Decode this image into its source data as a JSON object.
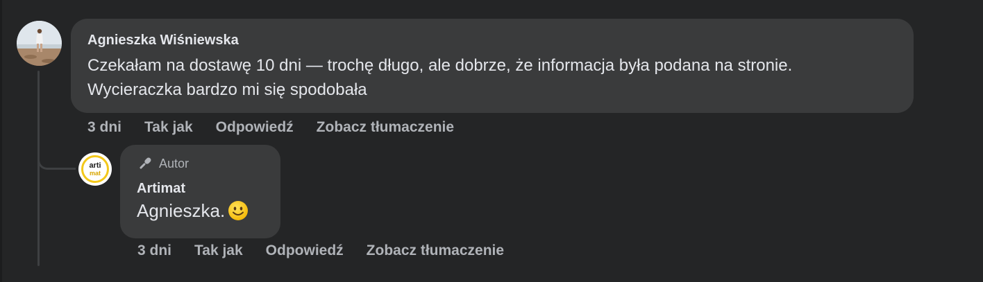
{
  "main_comment": {
    "author": "Agnieszka Wiśniewska",
    "text": "Czekałam na dostawę 10 dni — trochę długo, ale dobrze, że informacja była podana na stronie. Wycieraczka bardzo mi się spodobała",
    "time": "3 dni",
    "actions": {
      "like": "Tak jak",
      "reply": "Odpowiedź",
      "translate": "Zobacz tłumaczenie"
    }
  },
  "reply_comment": {
    "badge_icon": "microphone-icon",
    "badge": "Autor",
    "author": "Artimat",
    "text": "Agnieszka.",
    "emoji_icon": "smiley-emoji-icon",
    "avatar_logo": {
      "top": "arti",
      "bottom": "mat"
    },
    "time": "3 dni",
    "actions": {
      "like": "Tak jak",
      "reply": "Odpowiedź",
      "translate": "Zobacz tłumaczenie"
    }
  },
  "colors": {
    "background": "#242526",
    "bubble": "#3a3b3c",
    "primary_text": "#e4e6eb",
    "secondary_text": "#b0b3b8",
    "logo_accent": "#f3c81a"
  }
}
